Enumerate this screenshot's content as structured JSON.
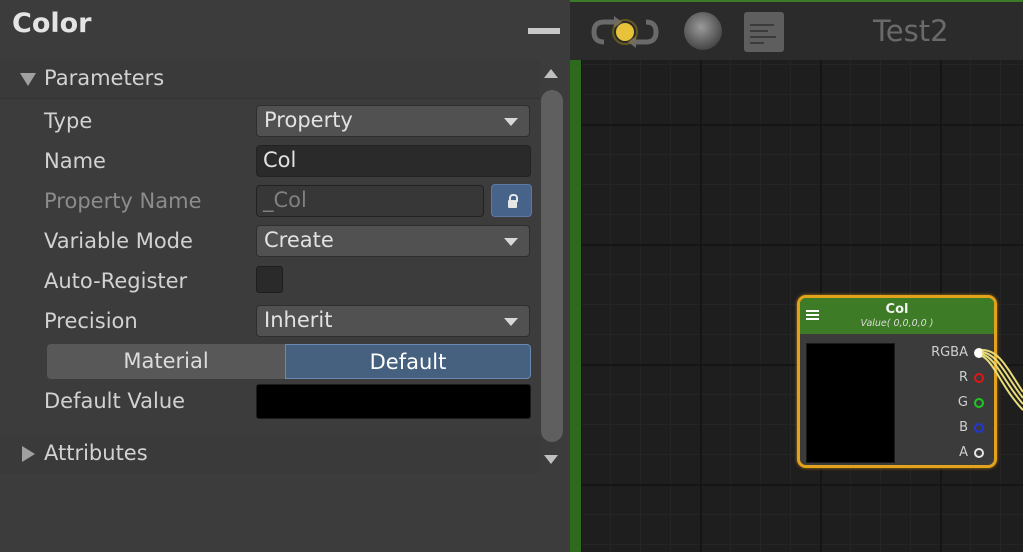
{
  "inspector": {
    "title": "Color",
    "sections": {
      "parameters": "Parameters",
      "attributes": "Attributes"
    },
    "fields": {
      "type": {
        "label": "Type",
        "value": "Property"
      },
      "name": {
        "label": "Name",
        "value": "Col"
      },
      "property_name": {
        "label": "Property Name",
        "value": "_Col"
      },
      "variable_mode": {
        "label": "Variable Mode",
        "value": "Create"
      },
      "auto_register": {
        "label": "Auto-Register",
        "checked": false
      },
      "precision": {
        "label": "Precision",
        "value": "Inherit"
      },
      "default_value": {
        "label": "Default Value",
        "color": "#000000"
      }
    },
    "toggle": {
      "left": "Material",
      "right": "Default",
      "selected": "Default"
    }
  },
  "canvas": {
    "graph_title": "Test2",
    "node": {
      "title": "Col",
      "subtitle": "Value( 0,0,0,0 )",
      "ports": [
        {
          "label": "RGBA",
          "color": "#ffffff"
        },
        {
          "label": "R",
          "color": "#e01515"
        },
        {
          "label": "G",
          "color": "#1fc81f"
        },
        {
          "label": "B",
          "color": "#2436d8"
        },
        {
          "label": "A",
          "color": "#e6e6e6"
        }
      ]
    }
  },
  "colors": {
    "accent_blue": "#46607f",
    "node_header": "#3d7b26",
    "node_selected_outline": "#e3a21c"
  }
}
